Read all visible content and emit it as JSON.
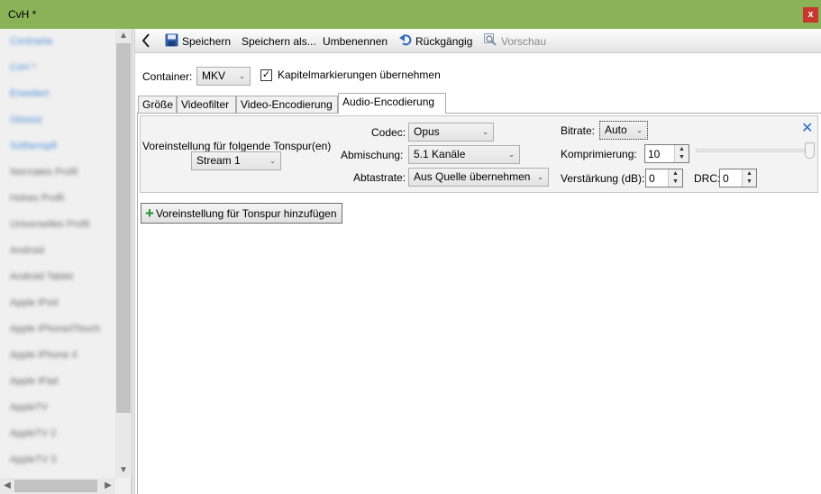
{
  "window": {
    "title": "CvH *",
    "close_label": "x"
  },
  "sidebar": {
    "items": [
      {
        "label": "Contraste",
        "color": "blue"
      },
      {
        "label": "CvH *",
        "color": "blue"
      },
      {
        "label": "Erweitert",
        "color": "blue"
      },
      {
        "label": "Glossiz",
        "color": "blue"
      },
      {
        "label": "Sotbenspfi",
        "color": "blue"
      },
      {
        "label": "Normales Profil",
        "color": "gray"
      },
      {
        "label": "Hohes Profil",
        "color": "gray"
      },
      {
        "label": "Universelles Profil",
        "color": "gray"
      },
      {
        "label": "Android",
        "color": "gray"
      },
      {
        "label": "Android Tablet",
        "color": "gray"
      },
      {
        "label": "Apple iPod",
        "color": "gray"
      },
      {
        "label": "Apple iPhone/iTouch",
        "color": "gray"
      },
      {
        "label": "Apple iPhone 4",
        "color": "gray"
      },
      {
        "label": "Apple iPad",
        "color": "gray"
      },
      {
        "label": "AppleTV",
        "color": "gray"
      },
      {
        "label": "AppleTV 2",
        "color": "gray"
      },
      {
        "label": "AppleTV 3",
        "color": "gray"
      }
    ]
  },
  "toolbar": {
    "back_icon": "chevron-left-icon",
    "save_label": "Speichern",
    "save_as_label": "Speichern als...",
    "rename_label": "Umbenennen",
    "undo_label": "Rückgängig",
    "preview_label": "Vorschau"
  },
  "container": {
    "label": "Container:",
    "value": "MKV",
    "chapter_checkbox_label": "Kapitelmarkierungen übernehmen",
    "chapter_checked": true
  },
  "tabs": [
    {
      "label": "Größe",
      "active": false
    },
    {
      "label": "Videofilter",
      "active": false
    },
    {
      "label": "Video-Encodierung",
      "active": false
    },
    {
      "label": "Audio-Encodierung",
      "active": true
    }
  ],
  "audio": {
    "preset_label": "Voreinstellung für folgende Tonspur(en)",
    "track_value": "Stream 1",
    "codec_label": "Codec:",
    "codec_value": "Opus",
    "mixdown_label": "Abmischung:",
    "mixdown_value": "5.1 Kanäle",
    "samplerate_label": "Abtastrate:",
    "samplerate_value": "Aus Quelle übernehmen",
    "bitrate_label": "Bitrate:",
    "bitrate_value": "Auto",
    "compression_label": "Komprimierung:",
    "compression_value": "10",
    "gain_label": "Verstärkung (dB):",
    "gain_value": "0",
    "drc_label": "DRC:",
    "drc_value": "0",
    "add_button_label": "Voreinstellung für Tonspur hinzufügen"
  },
  "colors": {
    "titlebar": "#89b356",
    "close_button": "#c8352c",
    "remove_icon": "#2a6bc2",
    "add_icon": "#1f8c2a"
  }
}
